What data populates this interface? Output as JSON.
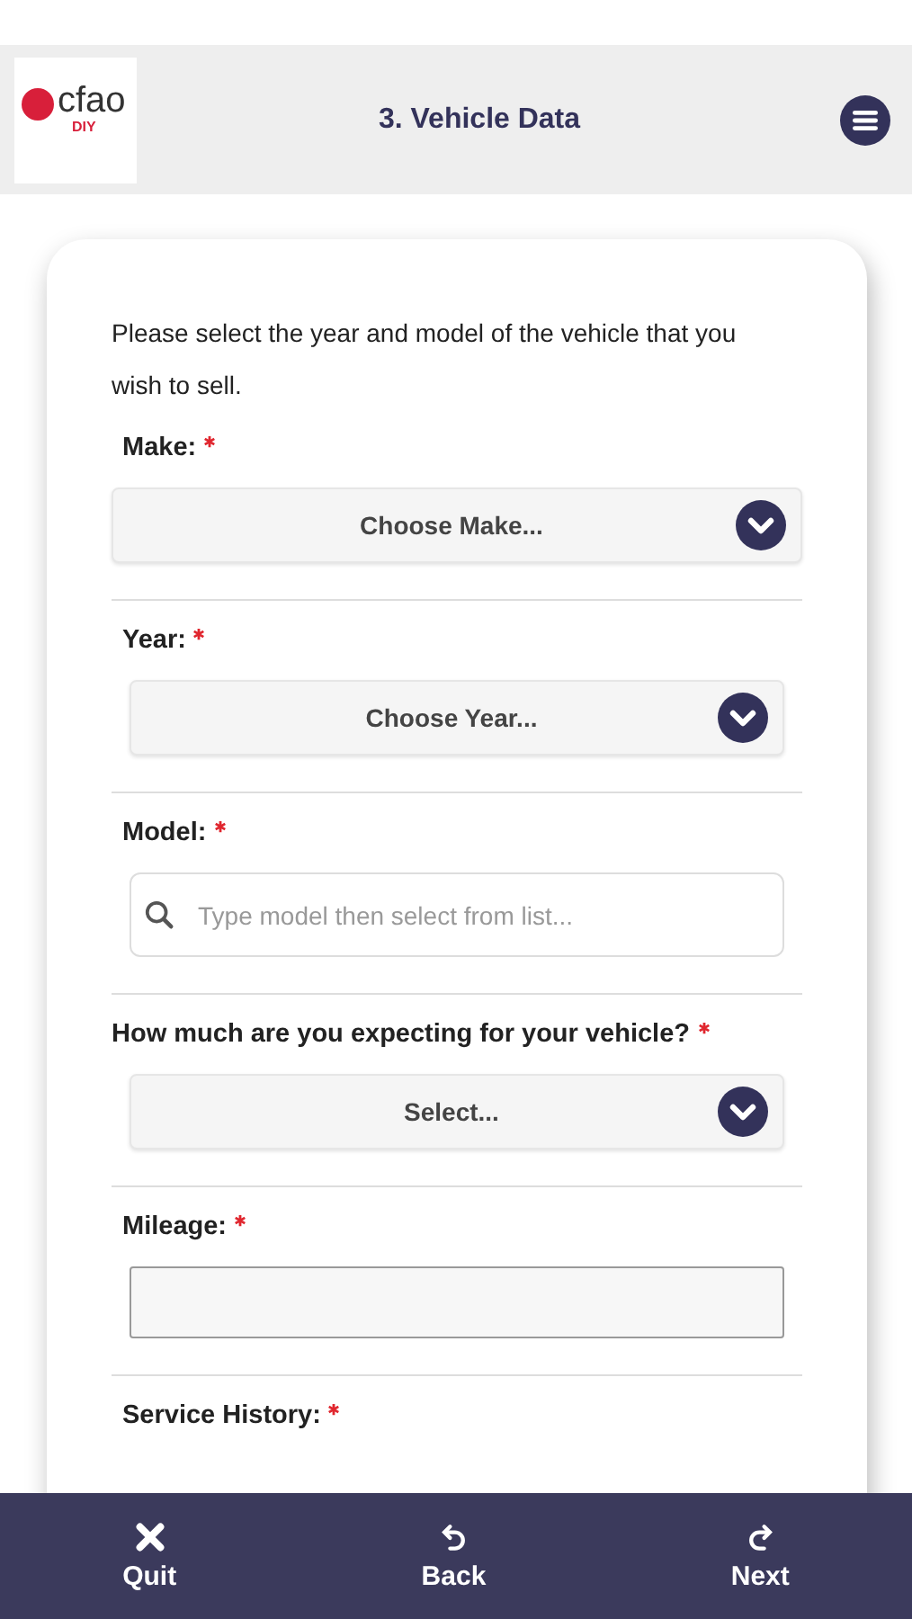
{
  "header": {
    "logo": {
      "name": "cfao",
      "sub": "DIY"
    },
    "title": "3. Vehicle Data"
  },
  "intro": "Please select the year and model of the vehicle that you wish to sell.",
  "fields": [
    {
      "kind": "select",
      "label": "Make:",
      "required": true,
      "value": "Choose Make..."
    },
    {
      "kind": "select",
      "label": "Year:",
      "required": true,
      "value": "Choose Year..."
    },
    {
      "kind": "search",
      "label": "Model:",
      "required": true,
      "placeholder": "Type model then select from list..."
    },
    {
      "kind": "select",
      "label": "How much are you expecting for your vehicle?",
      "required": true,
      "value": "Select..."
    },
    {
      "kind": "text",
      "label": "Mileage:",
      "required": true
    },
    {
      "kind": "cut",
      "label": "Service History:",
      "required": true
    }
  ],
  "footer": [
    {
      "kind": "quit",
      "label": "Quit"
    },
    {
      "kind": "back",
      "label": "Back"
    },
    {
      "kind": "next",
      "label": "Next"
    }
  ]
}
